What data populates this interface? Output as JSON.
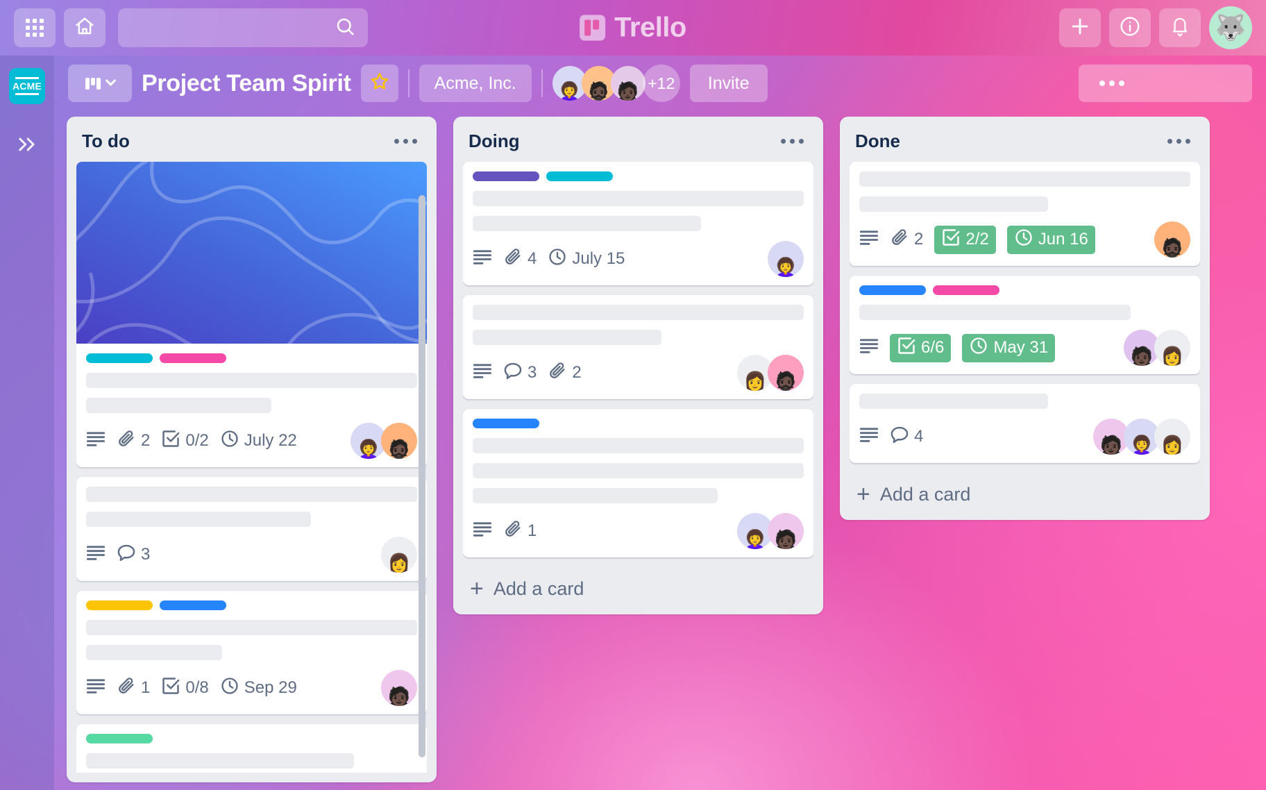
{
  "topnav": {
    "apps_icon": "grid-apps-icon",
    "home_icon": "home-icon",
    "search_placeholder": "",
    "search_value": "",
    "search_icon": "search-icon",
    "brand_name": "Trello",
    "brand_icon": "trello-board-logo",
    "add_icon": "plus-icon",
    "info_icon": "info-circle-icon",
    "notifications_icon": "bell-icon",
    "avatar_icon": "husky-dog-avatar"
  },
  "rail": {
    "workspace_logo_text": "ACME",
    "expand_icon": "double-chevron-right-icon"
  },
  "board_header": {
    "view_icon": "board-columns-icon",
    "view_chevron_icon": "chevron-down-icon",
    "title": "Project Team Spirit",
    "star_icon": "star-icon",
    "workspace": "Acme, Inc.",
    "member_count_more": "+12",
    "invite_label": "Invite",
    "more_icon": "ellipsis-icon",
    "members": [
      {
        "avatar": "woman-glasses-yellow",
        "bg": "#d8d9f5"
      },
      {
        "avatar": "man-beard-glasses",
        "bg": "#ffc18a"
      },
      {
        "avatar": "person-teal-top",
        "bg": "#e5c9e8"
      }
    ]
  },
  "lists": [
    {
      "title": "To do",
      "menu_icon": "ellipsis-icon",
      "has_scrollbar": true,
      "add_card_label": "",
      "cards": [
        {
          "cover": "blue-abstract-waves",
          "labels": [
            "#00BCD4",
            "#F549A8"
          ],
          "placeholder_widths": [
            "100%",
            "56%"
          ],
          "badges": [
            {
              "type": "description",
              "icon": "description-icon",
              "text": ""
            },
            {
              "type": "attachment",
              "icon": "paperclip-icon",
              "text": "2"
            },
            {
              "type": "checklist",
              "icon": "checkbox-icon",
              "text": "0/2"
            },
            {
              "type": "due",
              "icon": "clock-icon",
              "text": "July 22"
            }
          ],
          "avatars": [
            {
              "avatar": "woman-glasses-yellow",
              "bg": "#d8d9f5"
            },
            {
              "avatar": "man-beard-glasses",
              "bg": "#ffb27a"
            }
          ]
        },
        {
          "cover": null,
          "labels": [],
          "placeholder_widths": [
            "100%",
            "68%"
          ],
          "badges": [
            {
              "type": "description",
              "icon": "description-icon",
              "text": ""
            },
            {
              "type": "comment",
              "icon": "comment-icon",
              "text": "3"
            }
          ],
          "avatars": [
            {
              "avatar": "woman-bun-magenta",
              "bg": "#eceef2"
            }
          ]
        },
        {
          "cover": null,
          "labels": [
            "#FFC400",
            "#2684FF"
          ],
          "placeholder_widths": [
            "100%",
            "41%"
          ],
          "badges": [
            {
              "type": "description",
              "icon": "description-icon",
              "text": ""
            },
            {
              "type": "attachment",
              "icon": "paperclip-icon",
              "text": "1"
            },
            {
              "type": "checklist",
              "icon": "checkbox-icon",
              "text": "0/8"
            },
            {
              "type": "due",
              "icon": "clock-icon",
              "text": "Sep 29"
            }
          ],
          "avatars": [
            {
              "avatar": "person-teal-top",
              "bg": "#f0c7ec"
            }
          ]
        },
        {
          "cover": null,
          "labels": [
            "#57D9A3"
          ],
          "placeholder_widths": [
            "81%"
          ],
          "badges": [],
          "avatars": []
        }
      ]
    },
    {
      "title": "Doing",
      "menu_icon": "ellipsis-icon",
      "has_scrollbar": false,
      "add_card_label": "Add a card",
      "cards": [
        {
          "cover": null,
          "labels": [
            "#6554C0",
            "#00BCD4"
          ],
          "placeholder_widths": [
            "100%",
            "69%"
          ],
          "badges": [
            {
              "type": "description",
              "icon": "description-icon",
              "text": ""
            },
            {
              "type": "attachment",
              "icon": "paperclip-icon",
              "text": "4"
            },
            {
              "type": "due",
              "icon": "clock-icon",
              "text": "July 15"
            }
          ],
          "avatars": [
            {
              "avatar": "woman-glasses-yellow",
              "bg": "#d8d9f5"
            }
          ]
        },
        {
          "cover": null,
          "labels": [],
          "placeholder_widths": [
            "100%",
            "57%"
          ],
          "badges": [
            {
              "type": "description",
              "icon": "description-icon",
              "text": ""
            },
            {
              "type": "comment",
              "icon": "comment-icon",
              "text": "3"
            },
            {
              "type": "attachment",
              "icon": "paperclip-icon",
              "text": "2"
            }
          ],
          "avatars": [
            {
              "avatar": "woman-bun-magenta",
              "bg": "#eceef2"
            },
            {
              "avatar": "man-beard-glasses",
              "bg": "#ff9fc0"
            }
          ]
        },
        {
          "cover": null,
          "labels": [
            "#2684FF"
          ],
          "placeholder_widths": [
            "100%",
            "100%",
            "74%"
          ],
          "badges": [
            {
              "type": "description",
              "icon": "description-icon",
              "text": ""
            },
            {
              "type": "attachment",
              "icon": "paperclip-icon",
              "text": "1"
            }
          ],
          "avatars": [
            {
              "avatar": "woman-glasses-yellow",
              "bg": "#d8d9f5"
            },
            {
              "avatar": "person-teal-top",
              "bg": "#f0c7ec"
            }
          ]
        }
      ]
    },
    {
      "title": "Done",
      "menu_icon": "ellipsis-icon",
      "has_scrollbar": false,
      "add_card_label": "Add a card",
      "cards": [
        {
          "cover": null,
          "labels": [],
          "placeholder_widths": [
            "100%",
            "57%"
          ],
          "badges": [
            {
              "type": "description",
              "icon": "description-icon",
              "text": ""
            },
            {
              "type": "attachment",
              "icon": "paperclip-icon",
              "text": "2"
            },
            {
              "type": "checklist",
              "icon": "checkbox-icon",
              "text": "2/2",
              "complete": true
            },
            {
              "type": "due",
              "icon": "clock-icon",
              "text": "Jun 16",
              "complete": true
            }
          ],
          "avatars": [
            {
              "avatar": "man-beard-glasses",
              "bg": "#ffb27a"
            }
          ]
        },
        {
          "cover": null,
          "labels": [
            "#2684FF",
            "#F549A8"
          ],
          "placeholder_widths": [
            "82%"
          ],
          "badges": [
            {
              "type": "description",
              "icon": "description-icon",
              "text": ""
            },
            {
              "type": "checklist",
              "icon": "checkbox-icon",
              "text": "6/6",
              "complete": true
            },
            {
              "type": "due",
              "icon": "clock-icon",
              "text": "May 31",
              "complete": true
            }
          ],
          "avatars": [
            {
              "avatar": "person-teal-top",
              "bg": "#e0c2f0"
            },
            {
              "avatar": "woman-bun-magenta",
              "bg": "#eceef2"
            }
          ]
        },
        {
          "cover": null,
          "labels": [],
          "placeholder_widths": [
            "57%"
          ],
          "badges": [
            {
              "type": "description",
              "icon": "description-icon",
              "text": ""
            },
            {
              "type": "comment",
              "icon": "comment-icon",
              "text": "4"
            }
          ],
          "avatars": [
            {
              "avatar": "person-teal-top",
              "bg": "#f0c7ec"
            },
            {
              "avatar": "woman-glasses-yellow",
              "bg": "#d8d9f5"
            },
            {
              "avatar": "woman-bun-magenta",
              "bg": "#eceef2"
            }
          ]
        }
      ]
    }
  ],
  "colors": {
    "label_cyan": "#00BCD4",
    "label_pink": "#F549A8",
    "label_yellow": "#FFC400",
    "label_blue": "#2684FF",
    "label_green": "#57D9A3",
    "label_purple": "#6554C0",
    "badge_complete": "#61BD8C",
    "list_bg": "#EBECF0",
    "text_dark": "#172B4D",
    "text_muted": "#5E6C84",
    "acme_cyan": "#00BCD4"
  }
}
